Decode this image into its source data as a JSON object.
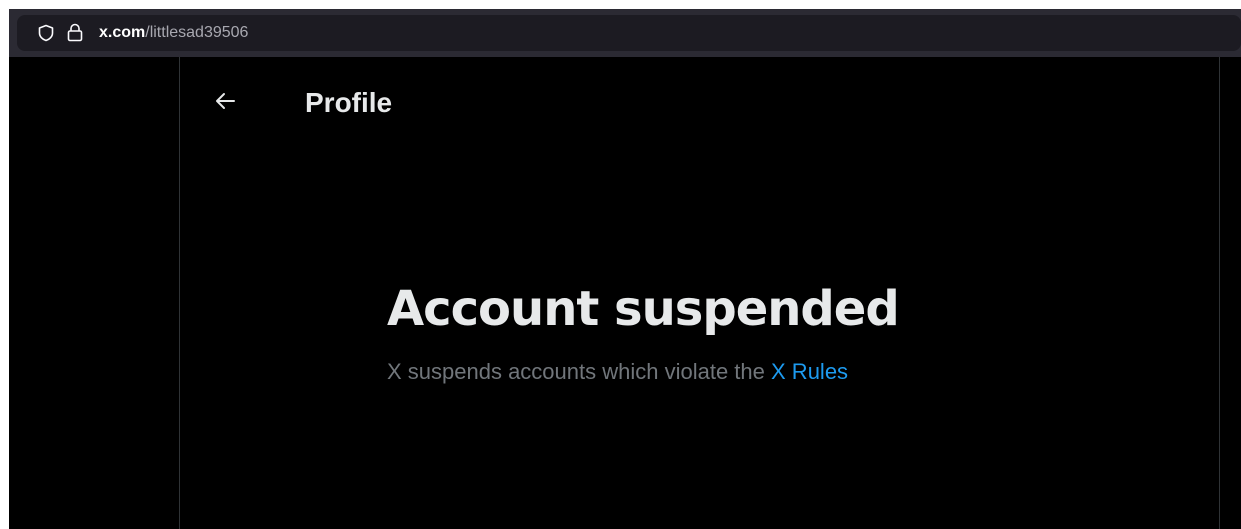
{
  "browser": {
    "url_host": "x.com",
    "url_path": "/littlesad39506",
    "icons": [
      "shield-icon",
      "lock-icon"
    ]
  },
  "header": {
    "back_icon": "arrow-left-icon",
    "title": "Profile"
  },
  "main": {
    "title": "Account suspended",
    "description": "X suspends accounts which violate the ",
    "link_text": "X Rules"
  },
  "colors": {
    "background": "#000000",
    "text_primary": "#e7e9ea",
    "text_secondary": "#71767b",
    "link": "#1d9bf0",
    "border": "#2f3336"
  }
}
